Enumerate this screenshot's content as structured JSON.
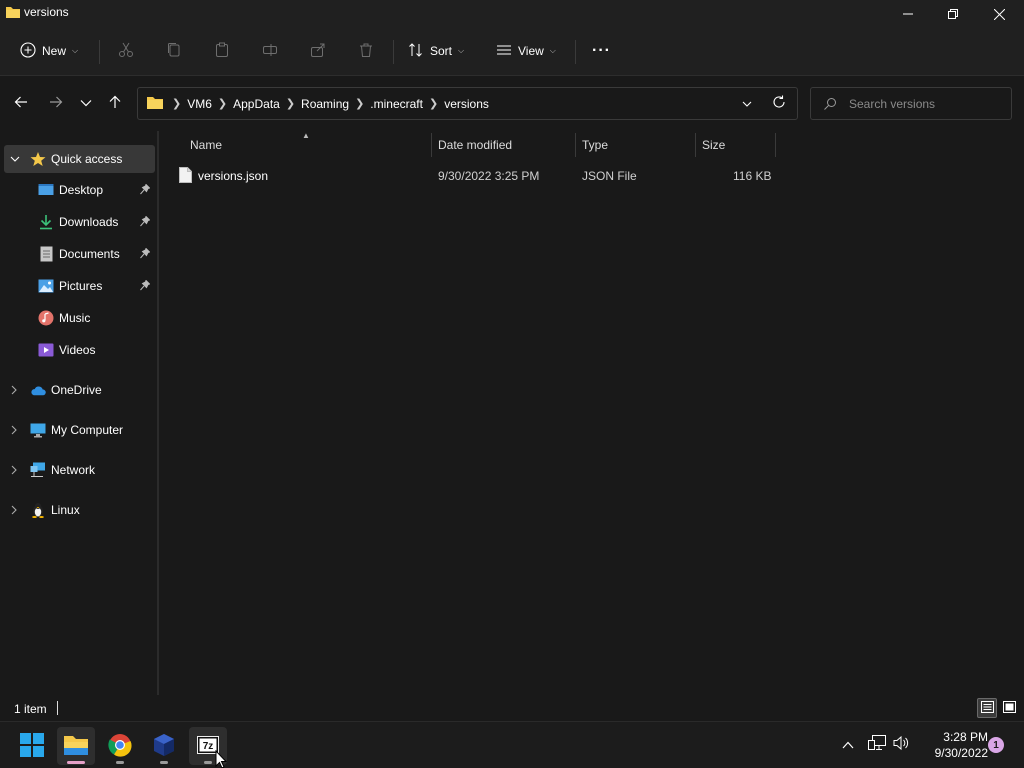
{
  "window": {
    "title": "versions"
  },
  "commandbar": {
    "new_label": "New",
    "sort_label": "Sort",
    "view_label": "View",
    "more_label": "···"
  },
  "address": {
    "crumbs": [
      "VM6",
      "AppData",
      "Roaming",
      ".minecraft",
      "versions"
    ],
    "search_placeholder": "Search versions"
  },
  "navpane": {
    "quick_access": "Quick access",
    "items": [
      {
        "label": "Desktop",
        "pinned": true
      },
      {
        "label": "Downloads",
        "pinned": true
      },
      {
        "label": "Documents",
        "pinned": true
      },
      {
        "label": "Pictures",
        "pinned": true
      },
      {
        "label": "Music",
        "pinned": false
      },
      {
        "label": "Videos",
        "pinned": false
      }
    ],
    "roots": [
      {
        "label": "OneDrive"
      },
      {
        "label": "My Computer"
      },
      {
        "label": "Network"
      },
      {
        "label": "Linux"
      }
    ]
  },
  "filelist": {
    "columns": [
      "Name",
      "Date modified",
      "Type",
      "Size"
    ],
    "rows": [
      {
        "name": "versions.json",
        "date": "9/30/2022 3:25 PM",
        "type": "JSON File",
        "size": "116 KB"
      }
    ]
  },
  "status": {
    "item_count": "1 item"
  },
  "taskbar": {
    "clock_time": "3:28 PM",
    "clock_date": "9/30/2022",
    "notification_count": "1"
  },
  "colors": {
    "window_bg": "#191919",
    "chrome_bg": "#202020",
    "selected_bg": "#383838",
    "folder_yellow": "#f4c84a",
    "accent_pink": "#e6a1c9"
  }
}
